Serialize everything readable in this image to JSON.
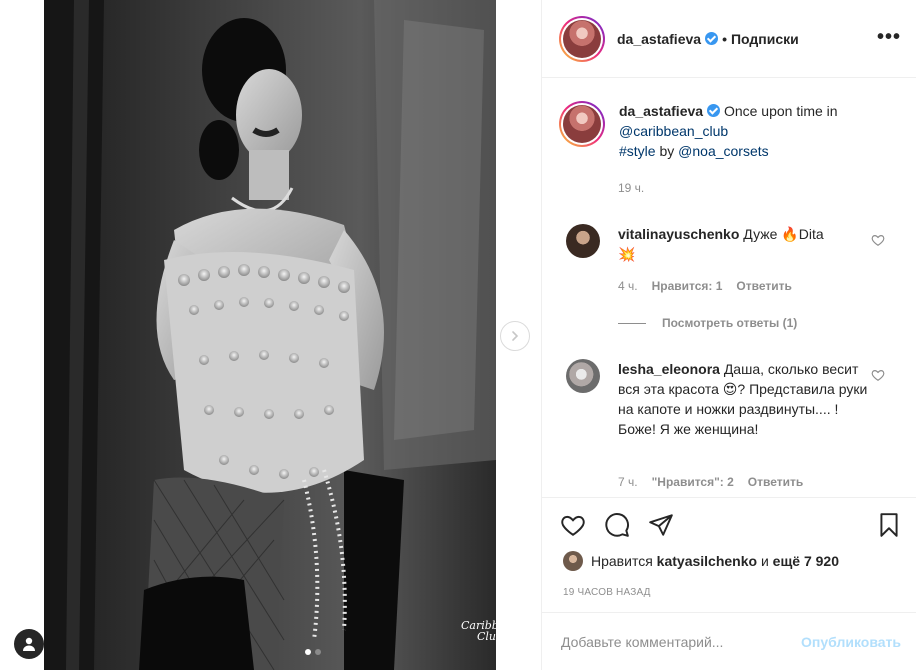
{
  "post": {
    "username": "da_astafieva",
    "follow_label": "Подписки",
    "more_label": "•••"
  },
  "caption": {
    "username": "da_astafieva",
    "text_start": "Once upon time in",
    "mention_club": "@caribbean_club",
    "hashtag": "#style",
    "by": "by",
    "mention_corsets": "@noa_corsets",
    "time": "19 ч."
  },
  "comments": [
    {
      "username": "vitalinayuschenko",
      "text_a": "Дуже",
      "emoji_a": "🔥",
      "text_b": "Dita",
      "emoji_b": "💥",
      "time": "4 ч.",
      "likes": "Нравится: 1",
      "reply": "Ответить"
    },
    {
      "username": "lesha_eleonora",
      "text_a": "Даша, сколько весит вся эта красота",
      "emoji_a": "😍",
      "text_b": "? Представила руки на капоте и ножки раздвинуты.... ! Боже! Я же женщина!",
      "time": "7 ч.",
      "likes": "\"Нравится\": 2",
      "reply": "Ответить"
    }
  ],
  "view_replies": "Посмотреть ответы (1)",
  "likes": {
    "prefix": "Нравится",
    "user": "katyasilchenko",
    "and": "и",
    "rest": "ещё 7 920"
  },
  "posted_ago": "19 ЧАСОВ НАЗАД",
  "comment_box": {
    "placeholder": "Добавьте комментарий...",
    "publish": "Опубликовать"
  },
  "media": {
    "logo_line1": "Caribbean",
    "logo_line2": "Club"
  },
  "colors": {
    "accent_blue": "#3897f0",
    "link": "#00376b",
    "muted": "#8e8e8e",
    "publish_disabled": "#b2dffc"
  }
}
